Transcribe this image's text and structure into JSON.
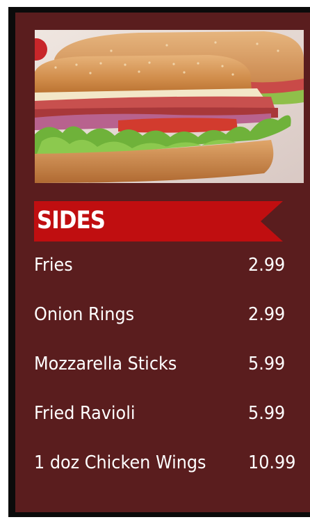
{
  "photo": {
    "subject": "sub-sandwich-photo"
  },
  "section": {
    "title": "SIDES",
    "colors": {
      "banner": "#c00e10",
      "panel": "#5a1d1e",
      "frame": "#0b0b0b"
    }
  },
  "menu": {
    "items": [
      {
        "name": "Fries",
        "price": "2.99"
      },
      {
        "name": "Onion Rings",
        "price": "2.99"
      },
      {
        "name": "Mozzarella Sticks",
        "price": "5.99"
      },
      {
        "name": "Fried Ravioli",
        "price": "5.99"
      },
      {
        "name": "1 doz Chicken Wings",
        "price": "10.99"
      }
    ]
  }
}
